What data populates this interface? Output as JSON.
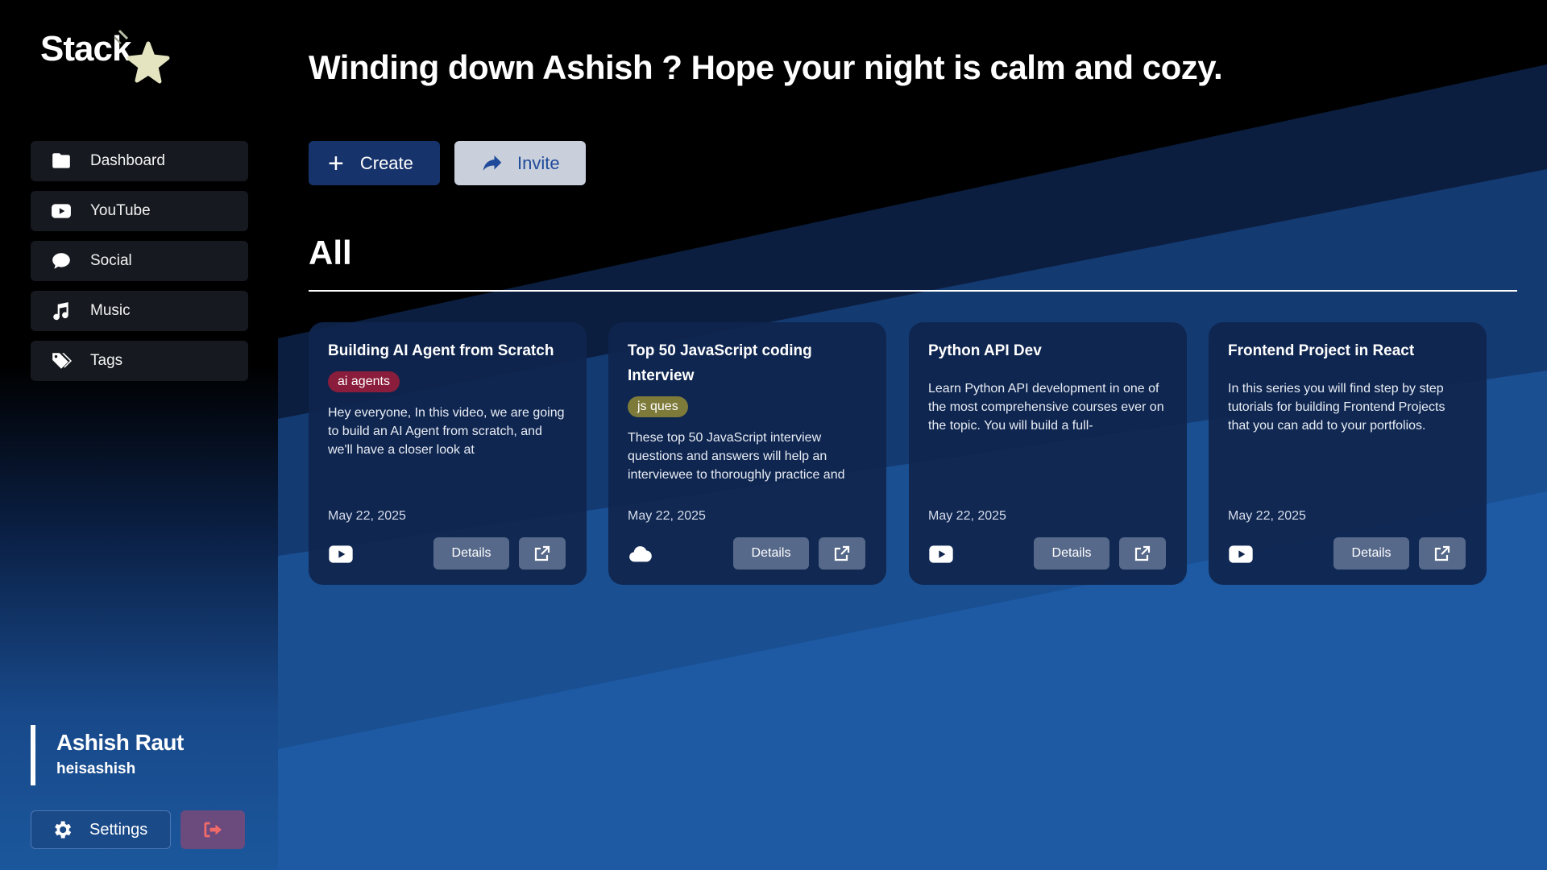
{
  "app": {
    "logo_text": "Stack"
  },
  "colors": {
    "accent": "#17336b",
    "invite_bg": "#c9cfdb",
    "invite_text": "#1f4b9a",
    "logout_icon": "#f06a6a"
  },
  "sidebar": {
    "items": [
      {
        "label": "Dashboard",
        "icon": "folder-icon"
      },
      {
        "label": "YouTube",
        "icon": "youtube-icon"
      },
      {
        "label": "Social",
        "icon": "chat-bubble-icon"
      },
      {
        "label": "Music",
        "icon": "music-note-icon"
      },
      {
        "label": "Tags",
        "icon": "tags-icon"
      }
    ],
    "user": {
      "name": "Ashish Raut",
      "handle": "heisashish"
    },
    "settings_label": "Settings"
  },
  "main": {
    "greeting": "Winding down Ashish ? Hope your night is calm and cozy.",
    "create_label": "Create",
    "invite_label": "Invite",
    "section_title": "All",
    "cards": [
      {
        "title": "Building AI Agent from Scratch",
        "tag": "ai agents",
        "tag_color": "#8b1d3c",
        "description": "Hey everyone, In this video, we are going to build an AI Agent from scratch, and we'll have a closer look at",
        "date": "May 22, 2025",
        "type_icon": "youtube-icon",
        "details_label": "Details"
      },
      {
        "title": "Top 50 JavaScript coding Interview",
        "tag": "js ques",
        "tag_color": "#7d7a3a",
        "description": "These top 50 JavaScript interview questions and answers will help an interviewee to thoroughly practice and",
        "date": "May 22, 2025",
        "type_icon": "cloud-icon",
        "details_label": "Details"
      },
      {
        "title": "Python API Dev",
        "tag": "",
        "tag_color": "",
        "description": "Learn Python API development in one of the most comprehensive courses ever on the topic. You will build a full-",
        "date": "May 22, 2025",
        "type_icon": "youtube-icon",
        "details_label": "Details"
      },
      {
        "title": "Frontend Project in React",
        "tag": "",
        "tag_color": "",
        "description": "In this series you will find step by step tutorials for building Frontend Projects that you can add to your portfolios.",
        "date": "May 22, 2025",
        "type_icon": "youtube-icon",
        "details_label": "Details"
      }
    ]
  }
}
